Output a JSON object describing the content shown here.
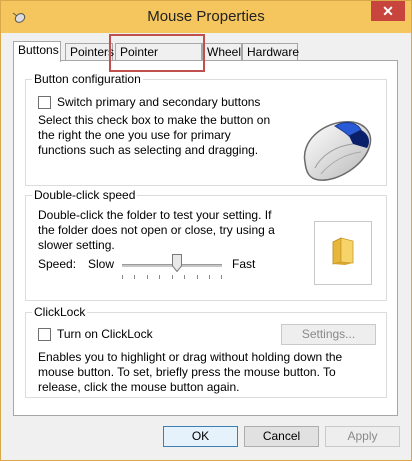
{
  "window": {
    "title": "Mouse Properties",
    "close_label": "✕"
  },
  "tabs": [
    {
      "label": "Buttons",
      "active": true
    },
    {
      "label": "Pointers",
      "active": false
    },
    {
      "label": "Pointer Options",
      "active": false
    },
    {
      "label": "Wheel",
      "active": false
    },
    {
      "label": "Hardware",
      "active": false
    }
  ],
  "button_configuration": {
    "legend": "Button configuration",
    "checkbox_label": "Switch primary and secondary buttons",
    "checked": false,
    "description": "Select this check box to make the button on the right the one you use for primary functions such as selecting and dragging."
  },
  "double_click": {
    "legend": "Double-click speed",
    "description": "Double-click the folder to test your setting. If the folder does not open or close, try using a slower setting.",
    "speed_label": "Speed:",
    "slow_label": "Slow",
    "fast_label": "Fast",
    "slider_value_percent": 55
  },
  "clicklock": {
    "legend": "ClickLock",
    "checkbox_label": "Turn on ClickLock",
    "checked": false,
    "settings_label": "Settings...",
    "description": "Enables you to highlight or drag without holding down the mouse button. To set, briefly press the mouse button. To release, click the mouse button again."
  },
  "footer": {
    "ok_label": "OK",
    "cancel_label": "Cancel",
    "apply_label": "Apply"
  },
  "colors": {
    "titlebar": "#f6c65e",
    "close_button": "#c7453d",
    "highlight": "#c0504d"
  },
  "icons": {
    "app": "mouse-app-icon",
    "preview": "mouse-preview-icon",
    "folder": "folder-icon"
  }
}
